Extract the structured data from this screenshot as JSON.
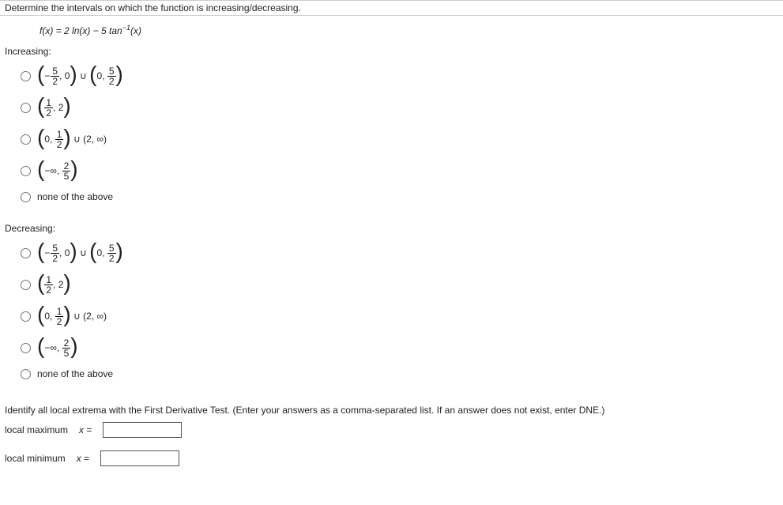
{
  "prompt": "Determine the intervals on which the function is increasing/decreasing.",
  "function": {
    "lhs": "f(x) = ",
    "coef1": "2 ln(",
    "var1": "x",
    "mid": ") − 5 tan",
    "exp": "−1",
    "tail": "(x)"
  },
  "sections": {
    "increasing": {
      "label": "Increasing:",
      "options": {
        "a": {
          "f1_num": "5",
          "f1_den": "2",
          "f2_num": "5",
          "f2_den": "2"
        },
        "b": {
          "f_num": "1",
          "f_den": "2",
          "right": "2"
        },
        "c": {
          "f_num": "1",
          "f_den": "2",
          "tail": " ∪ (2, ∞)"
        },
        "d": {
          "f_num": "2",
          "f_den": "5"
        },
        "e": {
          "text": "none of the above"
        }
      }
    },
    "decreasing": {
      "label": "Decreasing:",
      "options": {
        "a": {
          "f1_num": "5",
          "f1_den": "2",
          "f2_num": "5",
          "f2_den": "2"
        },
        "b": {
          "f_num": "1",
          "f_den": "2",
          "right": "2"
        },
        "c": {
          "f_num": "1",
          "f_den": "2",
          "tail": " ∪ (2, ∞)"
        },
        "d": {
          "f_num": "2",
          "f_den": "5"
        },
        "e": {
          "text": "none of the above"
        }
      }
    }
  },
  "extrema": {
    "instruction": "Identify all local extrema with the First Derivative Test. (Enter your answers as a comma-separated list. If an answer does not exist, enter DNE.)",
    "max_label": "local maximum",
    "min_label": "local minimum",
    "eq": "x ="
  },
  "sym": {
    "zero": "0",
    "neg": "−",
    "neginf": "−∞",
    "comma": ", ",
    "union": " ∪ "
  }
}
